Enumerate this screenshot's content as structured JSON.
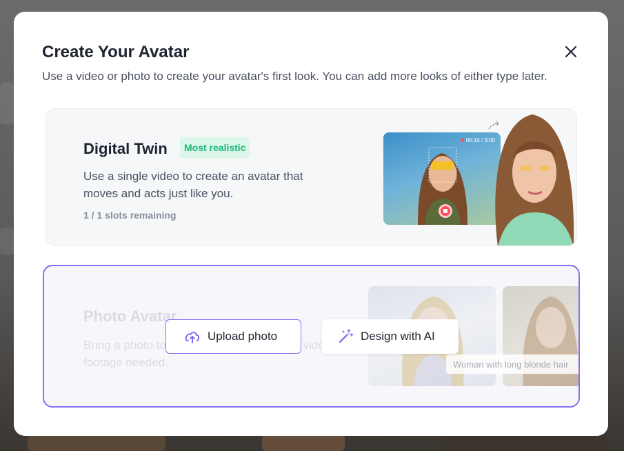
{
  "modal": {
    "title": "Create Your Avatar",
    "subtitle": "Use a video or photo to create your avatar's first look. You can add more looks of either type later."
  },
  "digital_twin": {
    "title": "Digital Twin",
    "badge": "Most realistic",
    "description": "Use a single video to create an avatar that moves and acts just like you.",
    "slots": "1 / 1 slots remaining",
    "recording_timer": "00:10 / 3:00"
  },
  "photo_avatar": {
    "title": "Photo Avatar",
    "description": "Bring a photo to life with AI animation - no video footage needed.",
    "upload_label": "Upload photo",
    "design_label": "Design with AI",
    "thumb_caption": "Woman with long blonde hair"
  },
  "colors": {
    "accent": "#8b6cf2",
    "badge_bg": "#dcf6ea",
    "badge_text": "#17b877",
    "record": "#ff4d5a"
  },
  "icons": [
    "close-icon",
    "cloud-upload-icon",
    "magic-wand-icon",
    "record-stop-icon"
  ]
}
